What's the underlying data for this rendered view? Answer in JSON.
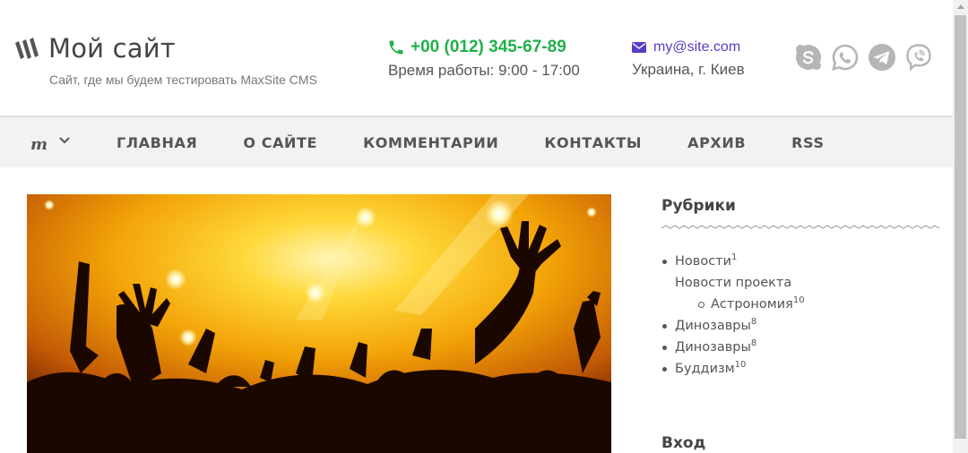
{
  "header": {
    "site_title": "Мой сайт",
    "site_description": "Сайт, где мы будем тестировать MaxSite CMS",
    "phone": "+00 (012) 345-67-89",
    "hours": "Время работы: 9:00 - 17:00",
    "email": "my@site.com",
    "city": "Украина, г. Киев",
    "socials": [
      "skype-icon",
      "whatsapp-icon",
      "telegram-icon",
      "viber-icon"
    ]
  },
  "nav": {
    "logo": "m",
    "items": [
      "ГЛАВНАЯ",
      "О САЙТЕ",
      "КОММЕНТАРИИ",
      "КОНТАКТЫ",
      "АРХИВ",
      "RSS"
    ]
  },
  "sidebar": {
    "categories_title": "Рубрики",
    "categories": [
      {
        "label": "Новости",
        "count": "1"
      },
      {
        "label": "Новости проекта",
        "count": ""
      },
      {
        "label": "Астрономия",
        "count": "10"
      },
      {
        "label": "Динозавры",
        "count": "8"
      },
      {
        "label": "Динозавры",
        "count": "8"
      },
      {
        "label": "Буддизм",
        "count": "10"
      }
    ],
    "login_title": "Вход"
  },
  "colors": {
    "phone": "#22b04a",
    "email": "#5b3cc4",
    "nav_bg": "#f2f2f2",
    "social_icons": "#b5b5b5"
  }
}
